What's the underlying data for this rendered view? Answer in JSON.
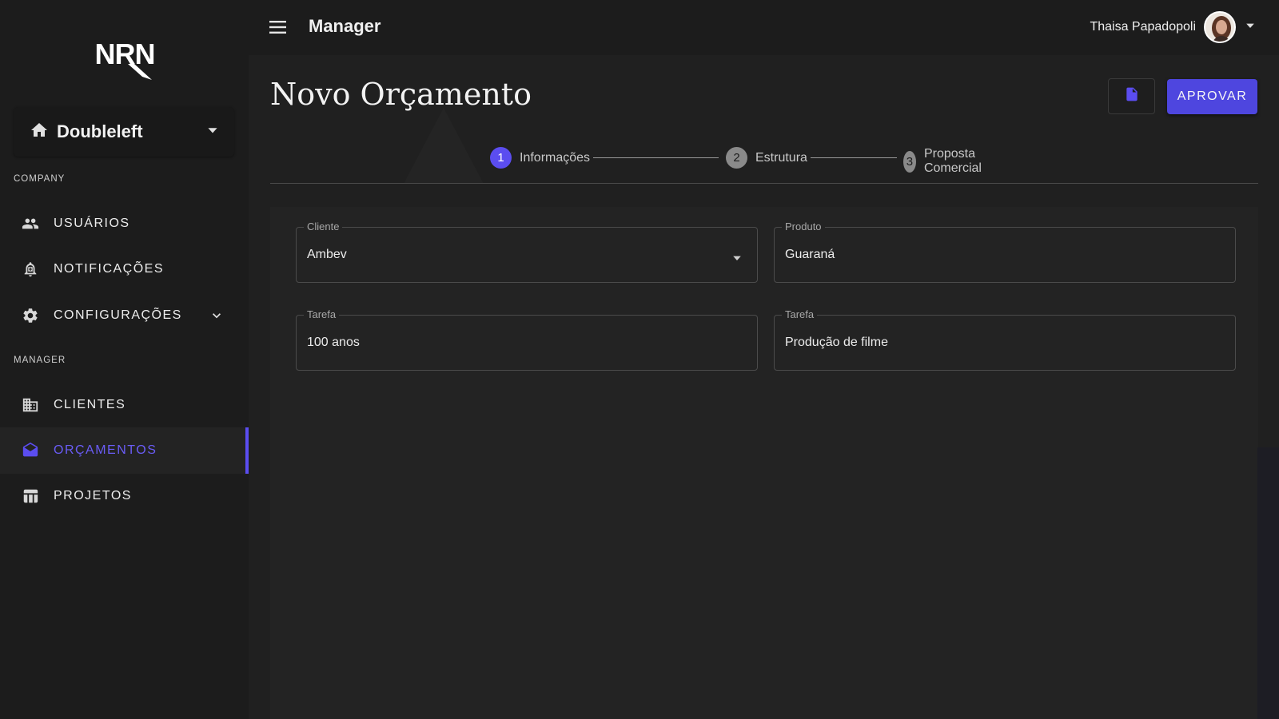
{
  "logo": {
    "text": "NRN"
  },
  "sidebar": {
    "workspace": {
      "label": "Doubleleft",
      "icon": "home-icon"
    },
    "sections": [
      {
        "label": "COMPANY"
      },
      {
        "label": "MANAGER"
      }
    ],
    "items": [
      {
        "label": "USUÁRIOS",
        "icon": "people-icon"
      },
      {
        "label": "NOTIFICAÇÕES",
        "icon": "bell-icon"
      },
      {
        "label": "CONFIGURAÇÕES",
        "icon": "gear-icon",
        "expandable": true
      },
      {
        "label": "CLIENTES",
        "icon": "building-icon"
      },
      {
        "label": "ORÇAMENTOS",
        "icon": "drafts-mail-icon",
        "active": true
      },
      {
        "label": "PROJETOS",
        "icon": "table-icon"
      }
    ]
  },
  "topbar": {
    "title": "Manager",
    "user_name": "Thaisa Papadopoli"
  },
  "page": {
    "title": "Novo Orçamento",
    "approve_label": "APROVAR"
  },
  "stepper": {
    "steps": [
      {
        "number": "1",
        "label": "Informações",
        "active": true
      },
      {
        "number": "2",
        "label": "Estrutura",
        "active": false
      },
      {
        "number": "3",
        "label": "Proposta Comercial",
        "active": false
      }
    ]
  },
  "form": {
    "cliente": {
      "label": "Cliente",
      "value": "Ambev"
    },
    "produto": {
      "label": "Produto",
      "value": "Guaraná"
    },
    "tarefa_left": {
      "label": "Tarefa",
      "value": "100 anos"
    },
    "tarefa_right": {
      "label": "Tarefa",
      "value": "Produção de filme"
    }
  },
  "colors": {
    "accent": "#5b4df0",
    "button": "#4e46df",
    "background": "#202020",
    "sidebar": "#1c1c1c",
    "panel": "#232323"
  }
}
